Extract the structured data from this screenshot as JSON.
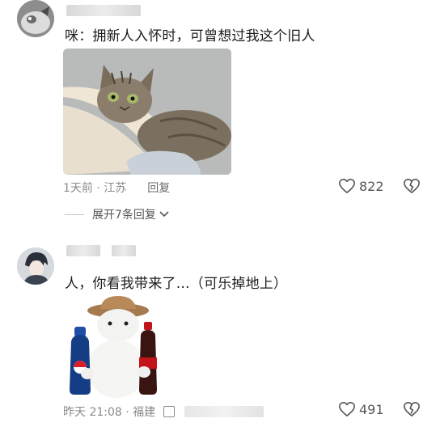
{
  "comments": [
    {
      "text": "咪：拥新人入怀时，可曾想过我这个旧人",
      "time_location": "1天前 · 江苏",
      "reply_label": "回复",
      "likes": "822",
      "expand_label": "展开7条回复"
    },
    {
      "text": "人，你看我带来了…（可乐掉地上）",
      "time_location": "昨天 21:08 · 福建",
      "likes": "491"
    }
  ],
  "icons": {
    "like": "heart-outline-icon",
    "dislike": "broken-heart-icon",
    "expand": "chevron-down-icon"
  },
  "colors": {
    "text": "#1c1c1c",
    "meta": "#8a8a8a",
    "pepsi": "#1e4fa8",
    "cola": "#c4141b"
  }
}
